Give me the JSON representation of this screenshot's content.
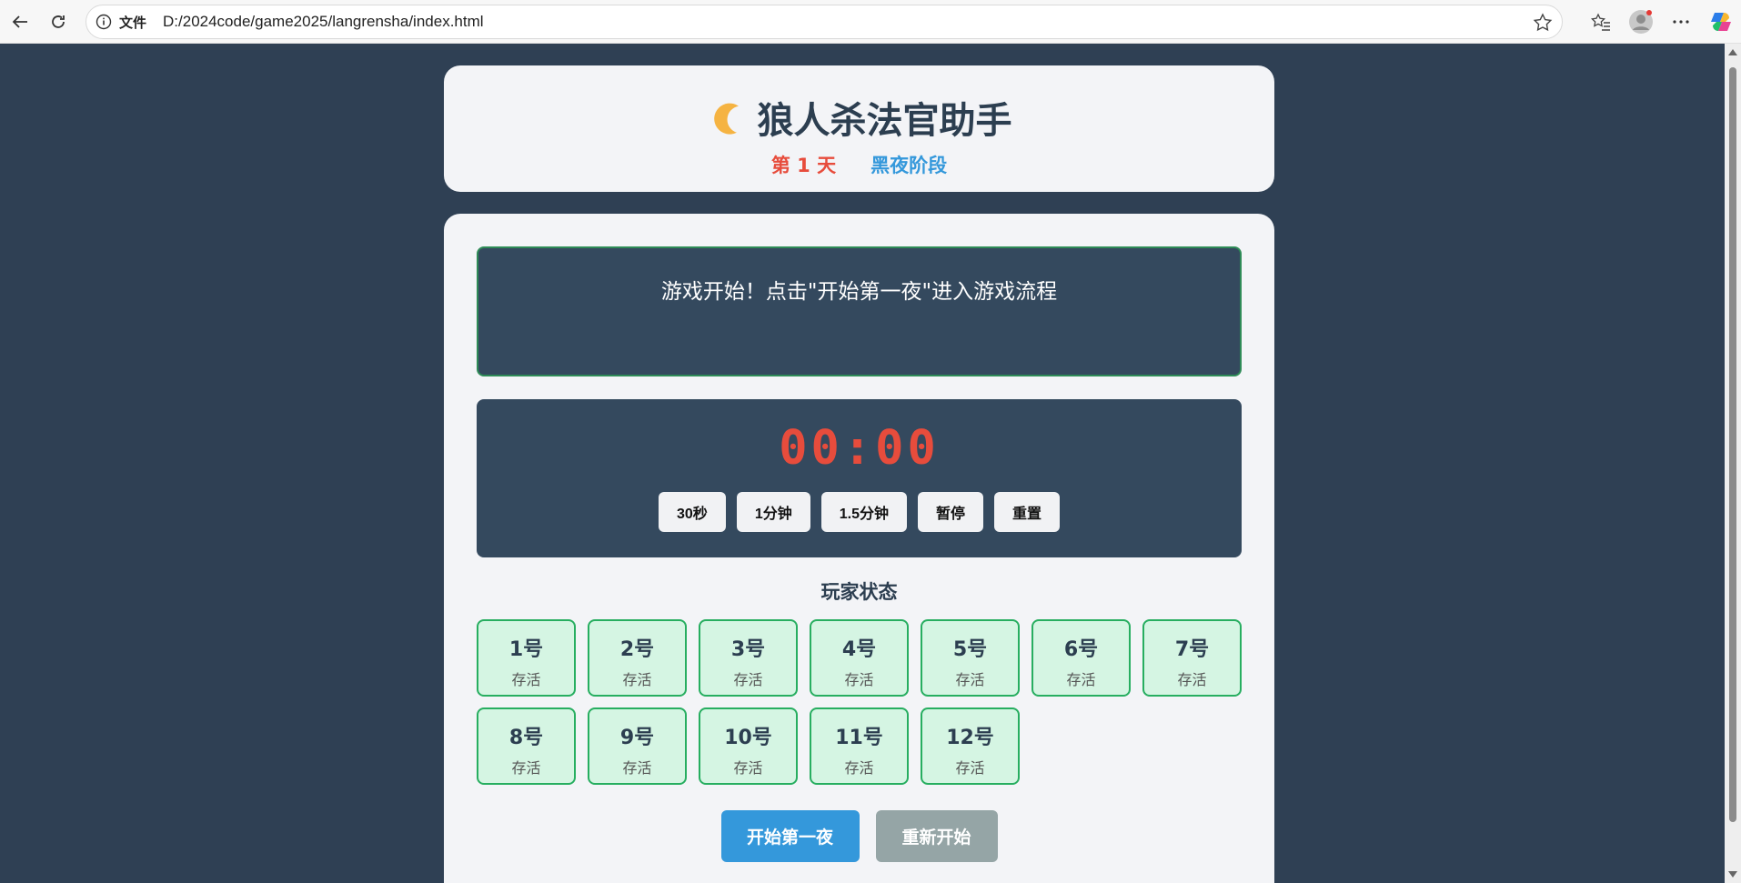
{
  "browser": {
    "file_label": "文件",
    "url": "D:/2024code/game2025/langrensha/index.html"
  },
  "header": {
    "title": "狼人杀法官助手",
    "day_label": "第 1 天",
    "phase_label": "黑夜阶段"
  },
  "message": {
    "text": "游戏开始！点击\"开始第一夜\"进入游戏流程"
  },
  "timer": {
    "display": "00:00",
    "buttons": [
      "30秒",
      "1分钟",
      "1.5分钟",
      "暂停",
      "重置"
    ]
  },
  "players_section": {
    "title": "玩家状态",
    "players": [
      {
        "num": "1号",
        "status": "存活"
      },
      {
        "num": "2号",
        "status": "存活"
      },
      {
        "num": "3号",
        "status": "存活"
      },
      {
        "num": "4号",
        "status": "存活"
      },
      {
        "num": "5号",
        "status": "存活"
      },
      {
        "num": "6号",
        "status": "存活"
      },
      {
        "num": "7号",
        "status": "存活"
      },
      {
        "num": "8号",
        "status": "存活"
      },
      {
        "num": "9号",
        "status": "存活"
      },
      {
        "num": "10号",
        "status": "存活"
      },
      {
        "num": "11号",
        "status": "存活"
      },
      {
        "num": "12号",
        "status": "存活"
      }
    ]
  },
  "actions": {
    "start_label": "开始第一夜",
    "restart_label": "重新开始"
  },
  "colors": {
    "background": "#2f4054",
    "card": "#f3f4f7",
    "panel": "#34495e",
    "day": "#e74c3c",
    "phase": "#3498db",
    "alive_fill": "#d5f5e3",
    "alive_border": "#27ae60"
  }
}
